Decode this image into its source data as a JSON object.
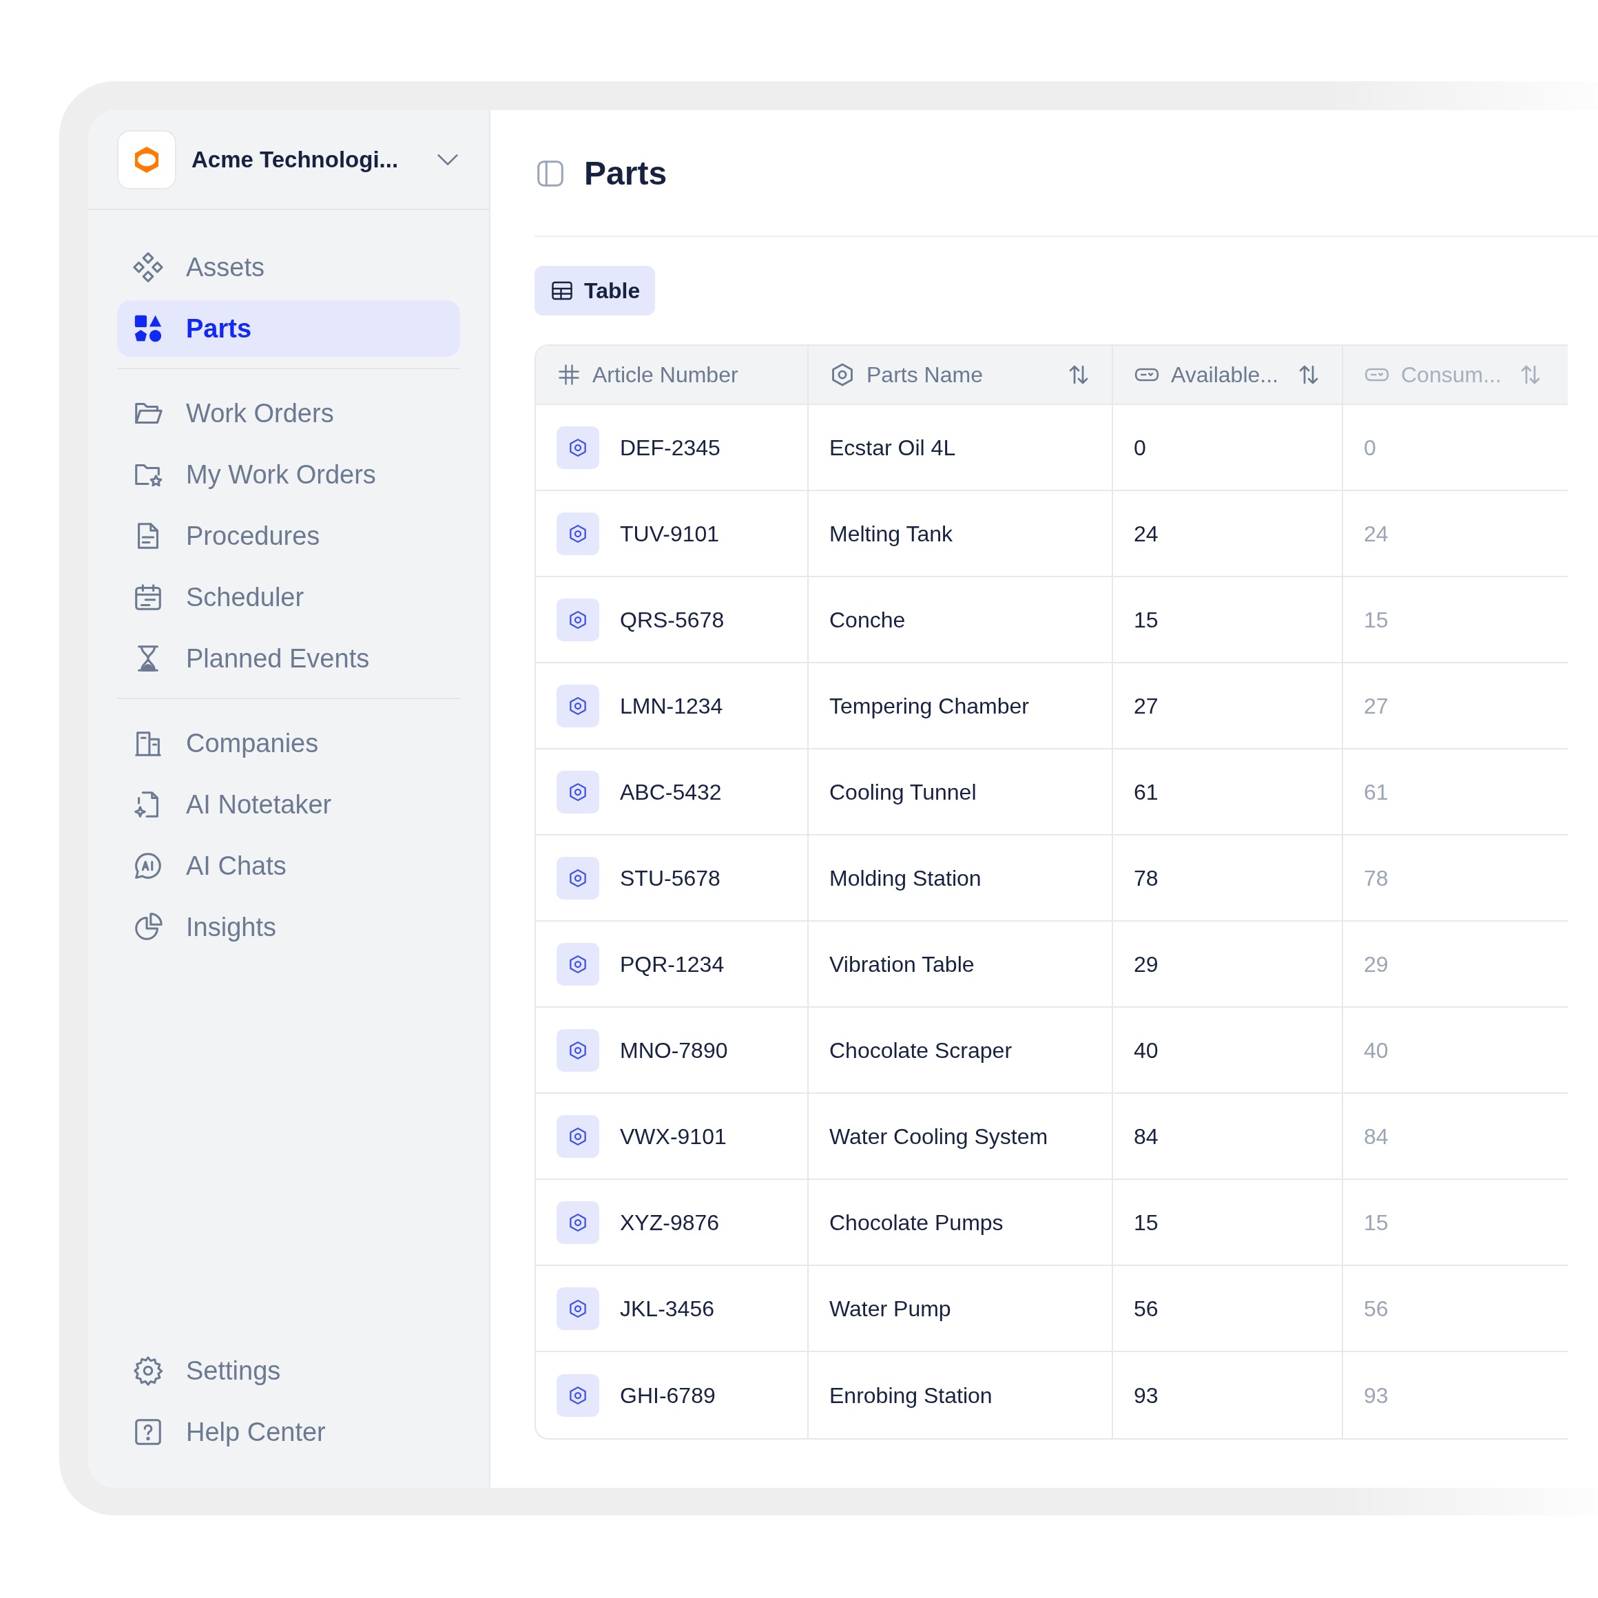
{
  "sidebar": {
    "org_name": "Acme Technologi...",
    "nav_groups": [
      [
        {
          "label": "Assets",
          "selected": false
        },
        {
          "label": "Parts",
          "selected": true
        }
      ],
      [
        {
          "label": "Work Orders",
          "selected": false
        },
        {
          "label": "My Work Orders",
          "selected": false
        },
        {
          "label": "Procedures",
          "selected": false
        },
        {
          "label": "Scheduler",
          "selected": false
        },
        {
          "label": "Planned Events",
          "selected": false
        }
      ],
      [
        {
          "label": "Companies",
          "selected": false
        },
        {
          "label": "AI Notetaker",
          "selected": false
        },
        {
          "label": "AI Chats",
          "selected": false
        },
        {
          "label": "Insights",
          "selected": false
        }
      ]
    ],
    "footer_items": [
      {
        "label": "Settings",
        "selected": false
      },
      {
        "label": "Help Center",
        "selected": false
      }
    ]
  },
  "page": {
    "title": "Parts",
    "view_tabs": [
      {
        "label": "Table",
        "selected": true
      }
    ]
  },
  "table": {
    "columns": [
      {
        "label": "Article Number",
        "sortable": false,
        "dimmed": false
      },
      {
        "label": "Parts Name",
        "sortable": true,
        "dimmed": false
      },
      {
        "label": "Available...",
        "sortable": true,
        "dimmed": false
      },
      {
        "label": "Consum...",
        "sortable": true,
        "dimmed": true
      }
    ],
    "rows": [
      [
        "DEF-2345",
        "Ecstar Oil 4L",
        "0",
        "0"
      ],
      [
        "TUV-9101",
        "Melting Tank",
        "24",
        "24"
      ],
      [
        "QRS-5678",
        "Conche",
        "15",
        "15"
      ],
      [
        "LMN-1234",
        "Tempering Chamber",
        "27",
        "27"
      ],
      [
        "ABC-5432",
        "Cooling Tunnel",
        "61",
        "61"
      ],
      [
        "STU-5678",
        "Molding Station",
        "78",
        "78"
      ],
      [
        "PQR-1234",
        "Vibration Table",
        "29",
        "29"
      ],
      [
        "MNO-7890",
        "Chocolate Scraper",
        "40",
        "40"
      ],
      [
        "VWX-9101",
        "Water Cooling System",
        "84",
        "84"
      ],
      [
        "XYZ-9876",
        "Chocolate Pumps",
        "15",
        "15"
      ],
      [
        "JKL-3456",
        "Water Pump",
        "56",
        "56"
      ],
      [
        "GHI-6789",
        "Enrobing Station",
        "93",
        "93"
      ]
    ]
  }
}
